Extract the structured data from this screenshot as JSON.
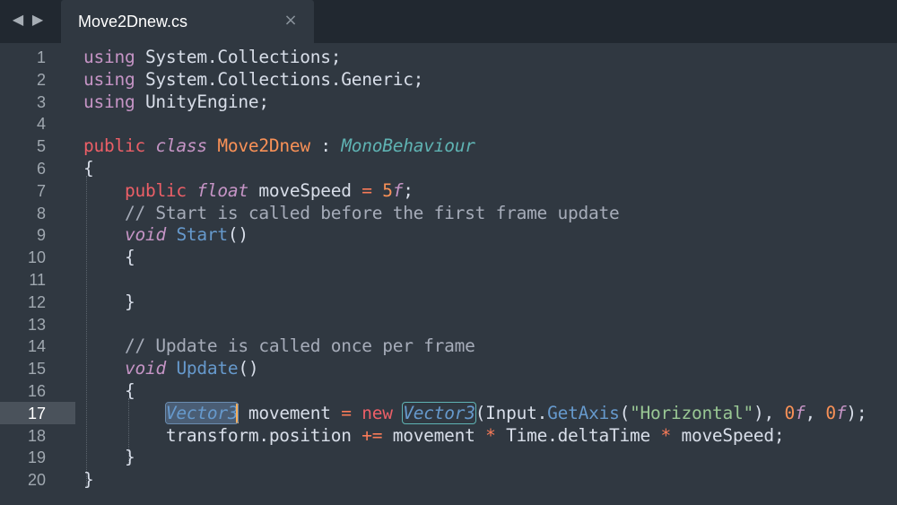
{
  "tabbar": {
    "back_icon": "◀",
    "forward_icon": "▶",
    "tab": {
      "label": "Move2Dnew.cs",
      "close_icon": "×"
    }
  },
  "editor": {
    "current_line": 17,
    "line_numbers": [
      "1",
      "2",
      "3",
      "4",
      "5",
      "6",
      "7",
      "8",
      "9",
      "10",
      "11",
      "12",
      "13",
      "14",
      "15",
      "16",
      "17",
      "18",
      "19",
      "20"
    ],
    "lines": [
      {
        "tokens": [
          {
            "t": "using",
            "c": "usekw"
          },
          {
            "t": " System.Collections;",
            "c": "punct"
          }
        ]
      },
      {
        "tokens": [
          {
            "t": "using",
            "c": "usekw"
          },
          {
            "t": " System.Collections.Generic;",
            "c": "punct"
          }
        ]
      },
      {
        "tokens": [
          {
            "t": "using",
            "c": "usekw"
          },
          {
            "t": " UnityEngine;",
            "c": "punct"
          }
        ]
      },
      {
        "tokens": []
      },
      {
        "tokens": [
          {
            "t": "public",
            "c": "kw"
          },
          {
            "t": " ",
            "c": "punct"
          },
          {
            "t": "class",
            "c": "kwi"
          },
          {
            "t": " ",
            "c": "punct"
          },
          {
            "t": "Move2Dnew",
            "c": "cls"
          },
          {
            "t": " : ",
            "c": "punct"
          },
          {
            "t": "MonoBehaviour",
            "c": "base"
          }
        ]
      },
      {
        "tokens": [
          {
            "t": "{",
            "c": "punct"
          }
        ]
      },
      {
        "tokens": [
          {
            "t": "    ",
            "c": "punct"
          },
          {
            "t": "public",
            "c": "kw"
          },
          {
            "t": " ",
            "c": "punct"
          },
          {
            "t": "float",
            "c": "kwi"
          },
          {
            "t": " moveSpeed ",
            "c": "punct"
          },
          {
            "t": "=",
            "c": "op"
          },
          {
            "t": " ",
            "c": "punct"
          },
          {
            "t": "5",
            "c": "num"
          },
          {
            "t": "f",
            "c": "num-suffix"
          },
          {
            "t": ";",
            "c": "punct"
          }
        ]
      },
      {
        "tokens": [
          {
            "t": "    // Start is called before the first frame update",
            "c": "cmt"
          }
        ]
      },
      {
        "tokens": [
          {
            "t": "    ",
            "c": "punct"
          },
          {
            "t": "void",
            "c": "kwi"
          },
          {
            "t": " ",
            "c": "punct"
          },
          {
            "t": "Start",
            "c": "fn"
          },
          {
            "t": "()",
            "c": "punct"
          }
        ]
      },
      {
        "tokens": [
          {
            "t": "    {",
            "c": "punct"
          }
        ]
      },
      {
        "tokens": []
      },
      {
        "tokens": [
          {
            "t": "    }",
            "c": "punct"
          }
        ]
      },
      {
        "tokens": []
      },
      {
        "tokens": [
          {
            "t": "    // Update is called once per frame",
            "c": "cmt"
          }
        ]
      },
      {
        "tokens": [
          {
            "t": "    ",
            "c": "punct"
          },
          {
            "t": "void",
            "c": "kwi"
          },
          {
            "t": " ",
            "c": "punct"
          },
          {
            "t": "Update",
            "c": "fn"
          },
          {
            "t": "()",
            "c": "punct"
          }
        ]
      },
      {
        "tokens": [
          {
            "t": "    {",
            "c": "punct"
          }
        ]
      },
      {
        "tokens": [
          {
            "t": "        ",
            "c": "punct"
          },
          {
            "t": "Vector3",
            "c": "typ hl-sel"
          },
          {
            "t": "",
            "c": "caret"
          },
          {
            "t": " movement ",
            "c": "punct"
          },
          {
            "t": "=",
            "c": "op"
          },
          {
            "t": " ",
            "c": "punct"
          },
          {
            "t": "new",
            "c": "kw"
          },
          {
            "t": " ",
            "c": "punct"
          },
          {
            "t": "Vector3",
            "c": "typ hl"
          },
          {
            "t": "(Input.",
            "c": "punct"
          },
          {
            "t": "GetAxis",
            "c": "fn"
          },
          {
            "t": "(",
            "c": "punct"
          },
          {
            "t": "\"Horizontal\"",
            "c": "str"
          },
          {
            "t": "), ",
            "c": "punct"
          },
          {
            "t": "0",
            "c": "num"
          },
          {
            "t": "f",
            "c": "num-suffix"
          },
          {
            "t": ", ",
            "c": "punct"
          },
          {
            "t": "0",
            "c": "num"
          },
          {
            "t": "f",
            "c": "num-suffix"
          },
          {
            "t": ");",
            "c": "punct"
          }
        ]
      },
      {
        "tokens": [
          {
            "t": "        transform.position ",
            "c": "punct"
          },
          {
            "t": "+=",
            "c": "op"
          },
          {
            "t": " movement ",
            "c": "punct"
          },
          {
            "t": "*",
            "c": "op"
          },
          {
            "t": " Time.deltaTime ",
            "c": "punct"
          },
          {
            "t": "*",
            "c": "op"
          },
          {
            "t": " moveSpeed;",
            "c": "punct"
          }
        ]
      },
      {
        "tokens": [
          {
            "t": "    }",
            "c": "punct"
          }
        ]
      },
      {
        "tokens": [
          {
            "t": "}",
            "c": "punct"
          }
        ]
      }
    ]
  },
  "colors": {
    "background": "#303841",
    "tabbar": "#212830",
    "keyword": "#ec5f67",
    "storage": "#c594c5",
    "class_name": "#f99157",
    "base_class": "#5fb3b3",
    "type": "#6699cc",
    "string": "#99c794",
    "comment": "#a6acb9",
    "caret": "#f9ae58"
  }
}
